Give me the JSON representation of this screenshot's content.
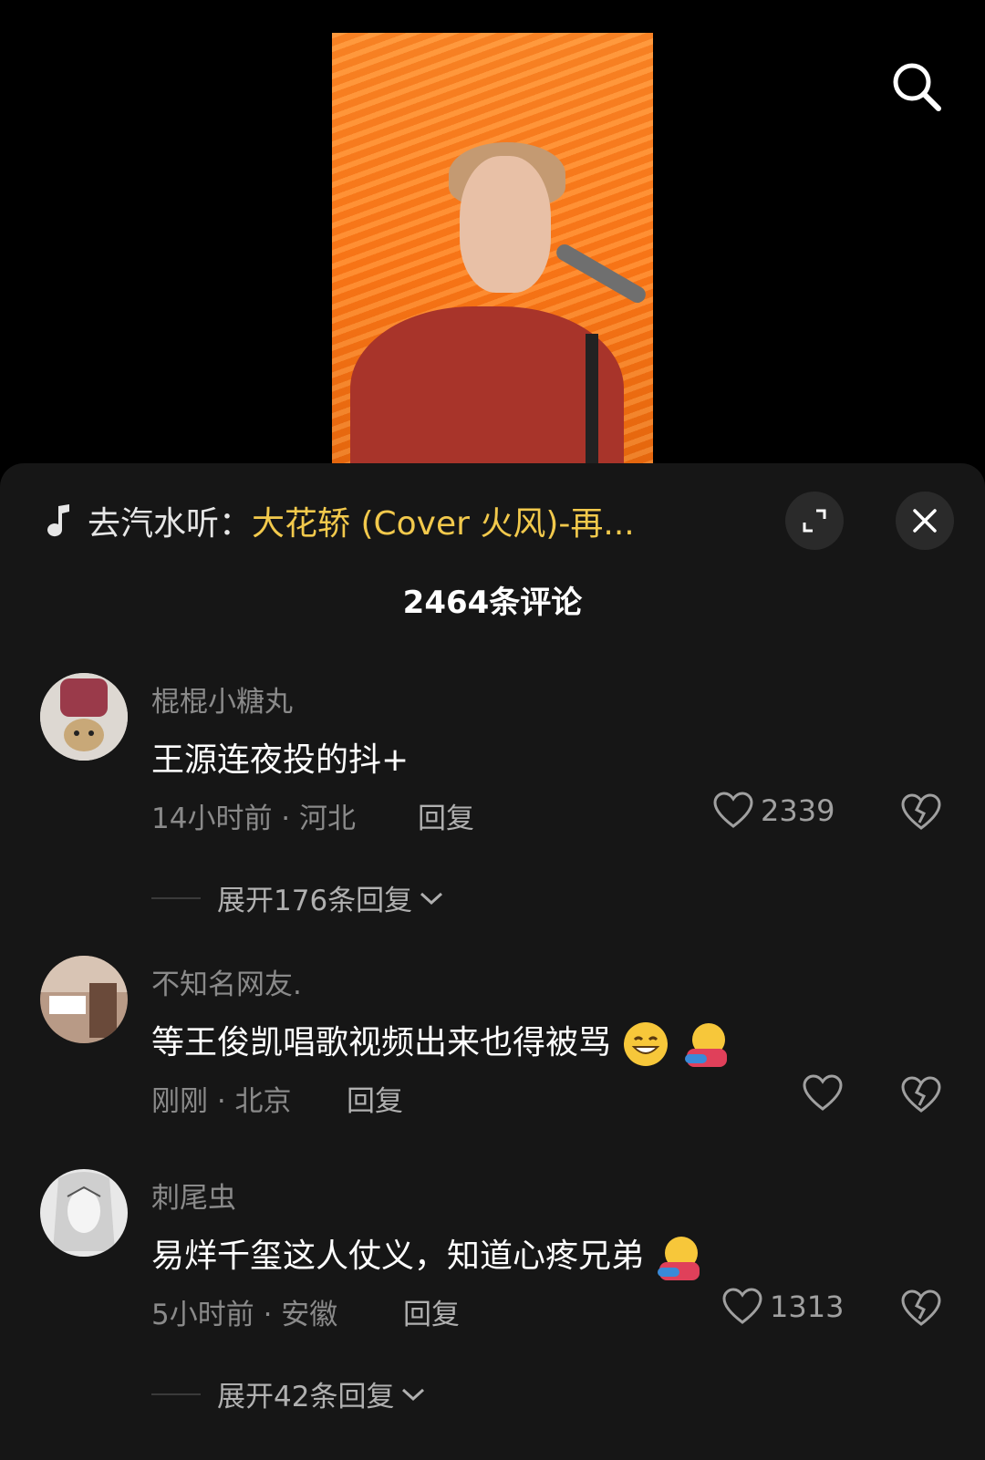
{
  "music": {
    "prefix": "去汽水听：",
    "title": "大花轿 (Cover 火风)-再...",
    "title_color": "#f2c94c"
  },
  "comment_count": "2464条评论",
  "comments": [
    {
      "username": "棍棍小糖丸",
      "text": "王源连夜投的抖+",
      "time_location": "14小时前 · 河北",
      "reply_label": "回复",
      "likes": "2339",
      "expand_replies": "展开176条回复"
    },
    {
      "username": "不知名网友.",
      "text": "等王俊凯唱歌视频出来也得被骂",
      "time_location": "刚刚 · 北京",
      "reply_label": "回复",
      "likes": ""
    },
    {
      "username": "刺尾虫",
      "text": "易烊千玺这人仗义，知道心疼兄弟",
      "time_location": "5小时前 · 安徽",
      "reply_label": "回复",
      "likes": "1313",
      "expand_replies": "展开42条回复"
    }
  ],
  "icons": {
    "search": "search-icon",
    "music": "music-note-icon",
    "expand": "expand-icon",
    "close": "close-icon",
    "like": "heart-icon",
    "dislike": "broken-heart-icon"
  }
}
